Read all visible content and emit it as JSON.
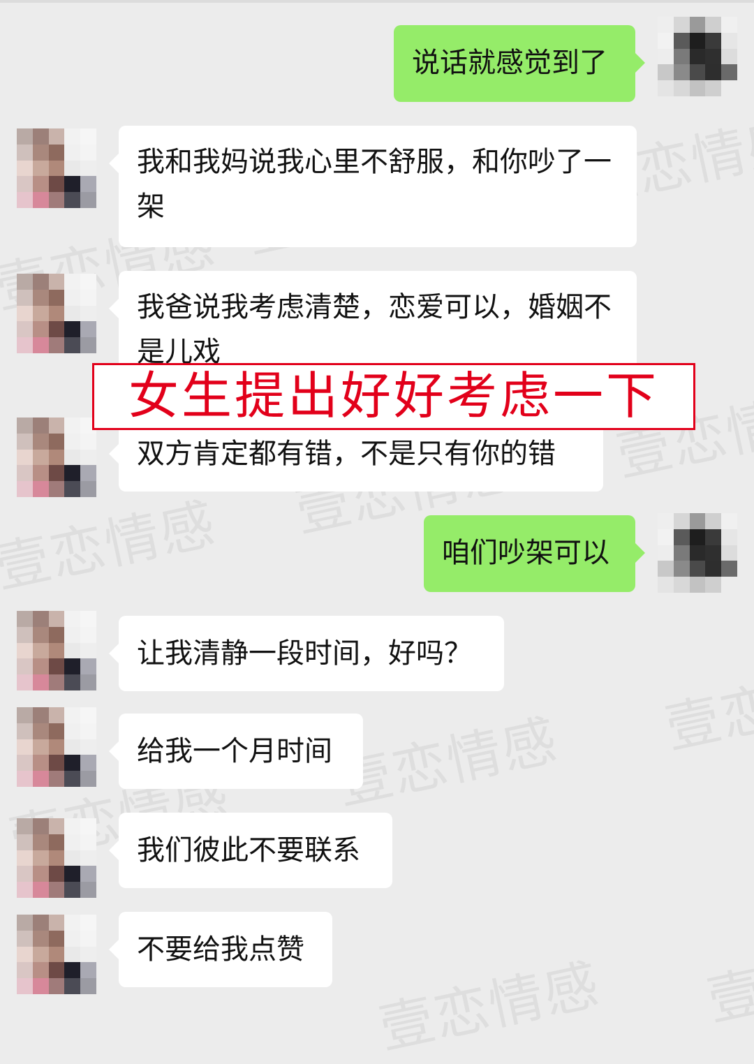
{
  "watermark": "壹恋情感",
  "banner": "女生提出好好考虑一下",
  "colors": {
    "background": "#ececec",
    "incoming_bubble": "#ffffff",
    "outgoing_bubble": "#95ec69",
    "banner_red": "#e2001a"
  },
  "messages": [
    {
      "side": "right",
      "text": "说话就感觉到了"
    },
    {
      "side": "left",
      "text": "我和我妈说我心里不舒服，和你吵了一架"
    },
    {
      "side": "left",
      "text": "我爸说我考虑清楚，恋爱可以，婚姻不是儿戏"
    },
    {
      "side": "left",
      "text": "双方肯定都有错，不是只有你的错"
    },
    {
      "side": "right",
      "text": "咱们吵架可以"
    },
    {
      "side": "left",
      "text": "让我清静一段时间，好吗？"
    },
    {
      "side": "left",
      "text": "给我一个月时间"
    },
    {
      "side": "left",
      "text": "我们彼此不要联系"
    },
    {
      "side": "left",
      "text": "不要给我点赞"
    }
  ]
}
